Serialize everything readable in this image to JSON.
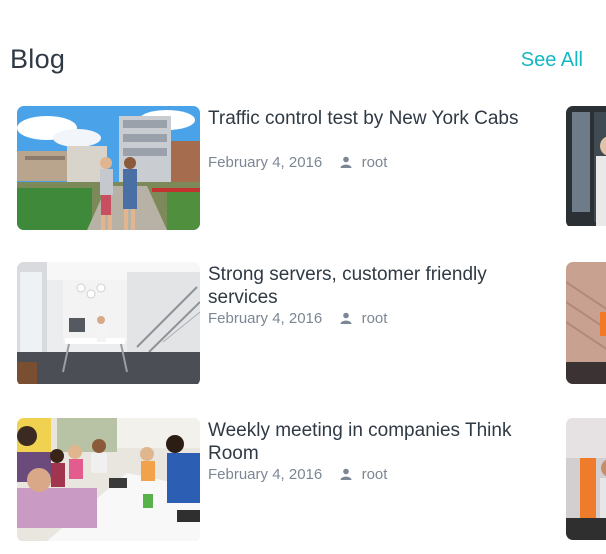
{
  "section": {
    "title": "Blog",
    "see_all_label": "See All"
  },
  "posts": [
    {
      "title": "Traffic control test by New York Cabs",
      "date": "February 4, 2016",
      "author": "root",
      "image": "city-rooftop-walkway-photo"
    },
    {
      "title": "Strong servers, customer friendly services",
      "date": "February 4, 2016",
      "author": "root",
      "image": "white-office-interior-photo"
    },
    {
      "title": "Weekly meeting in companies Think Room",
      "date": "February 4, 2016",
      "author": "root",
      "image": "conference-meeting-photo"
    }
  ],
  "icons": {
    "author": "user-icon"
  },
  "colors": {
    "accent": "#14b8c2",
    "title_text": "#2f3a45",
    "meta_text": "#7b8794"
  }
}
